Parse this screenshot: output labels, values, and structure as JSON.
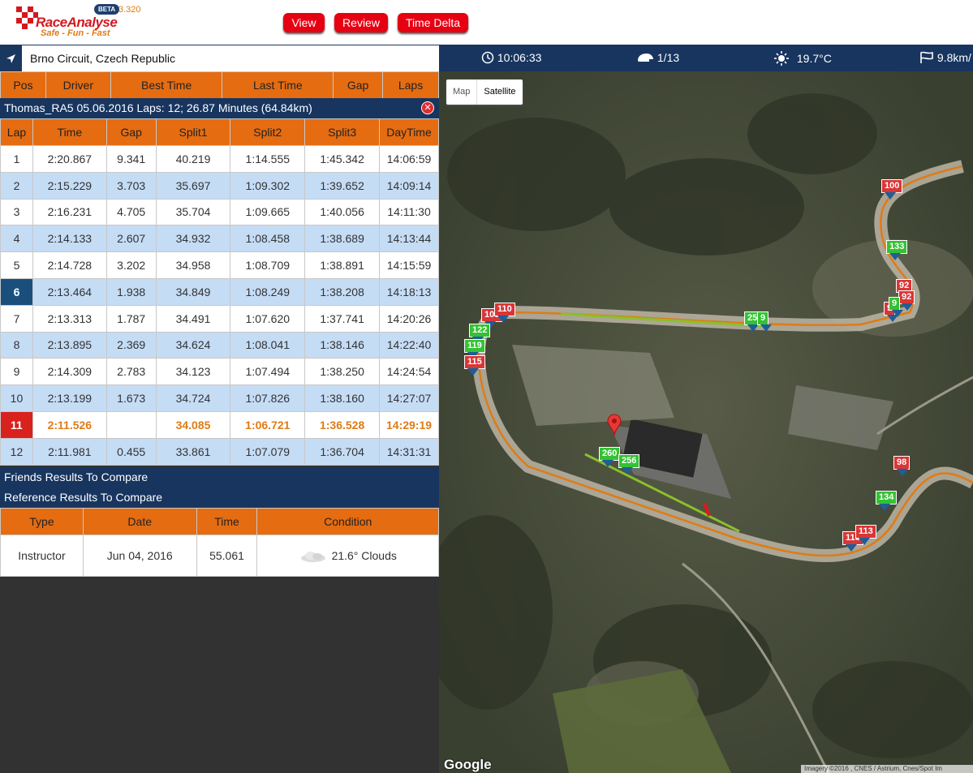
{
  "header": {
    "logo_name": "RaceAnalyse",
    "logo_slogan": "Safe - Fun - Fast",
    "beta": "BETA",
    "version": "3.320",
    "buttons": {
      "view": "View",
      "review": "Review",
      "time_delta": "Time Delta"
    }
  },
  "circuit": {
    "name": "Brno Circuit, Czech Republic",
    "icon": "navigation-arrow-icon"
  },
  "positions_table": {
    "columns": [
      "Pos",
      "Driver",
      "Best Time",
      "Last Time",
      "Gap",
      "Laps"
    ]
  },
  "session": {
    "title": "Thomas_RA5 05.06.2016 Laps: 12; 26.87 Minutes (64.84km)",
    "close_icon": "close-icon"
  },
  "laps": {
    "columns": [
      "Lap",
      "Time",
      "Gap",
      "Split1",
      "Split2",
      "Split3",
      "DayTime"
    ],
    "rows": [
      [
        "1",
        "2:20.867",
        "9.341",
        "40.219",
        "1:14.555",
        "1:45.342",
        "14:06:59"
      ],
      [
        "2",
        "2:15.229",
        "3.703",
        "35.697",
        "1:09.302",
        "1:39.652",
        "14:09:14"
      ],
      [
        "3",
        "2:16.231",
        "4.705",
        "35.704",
        "1:09.665",
        "1:40.056",
        "14:11:30"
      ],
      [
        "4",
        "2:14.133",
        "2.607",
        "34.932",
        "1:08.458",
        "1:38.689",
        "14:13:44"
      ],
      [
        "5",
        "2:14.728",
        "3.202",
        "34.958",
        "1:08.709",
        "1:38.891",
        "14:15:59"
      ],
      [
        "6",
        "2:13.464",
        "1.938",
        "34.849",
        "1:08.249",
        "1:38.208",
        "14:18:13"
      ],
      [
        "7",
        "2:13.313",
        "1.787",
        "34.491",
        "1:07.620",
        "1:37.741",
        "14:20:26"
      ],
      [
        "8",
        "2:13.895",
        "2.369",
        "34.624",
        "1:08.041",
        "1:38.146",
        "14:22:40"
      ],
      [
        "9",
        "2:14.309",
        "2.783",
        "34.123",
        "1:07.494",
        "1:38.250",
        "14:24:54"
      ],
      [
        "10",
        "2:13.199",
        "1.673",
        "34.724",
        "1:07.826",
        "1:38.160",
        "14:27:07"
      ],
      [
        "11",
        "2:11.526",
        "",
        "34.085",
        "1:06.721",
        "1:36.528",
        "14:29:19"
      ],
      [
        "12",
        "2:11.981",
        "0.455",
        "33.861",
        "1:07.079",
        "1:36.704",
        "14:31:31"
      ]
    ],
    "selected_lap": "6",
    "best_lap": "11"
  },
  "friends_title": "Friends Results To Compare",
  "reference_title": "Reference Results To Compare",
  "reference": {
    "columns": [
      "Type",
      "Date",
      "Time",
      "Condition"
    ],
    "rows": [
      {
        "type": "Instructor",
        "date": "Jun 04, 2016",
        "time": "55.061",
        "condition": "21.6° Clouds",
        "icon": "cloud-icon"
      }
    ]
  },
  "status": {
    "clock": "10:06:33",
    "laps": "1/13",
    "temperature": "19.7°C",
    "wind": "9.8km/",
    "icons": [
      "clock-icon",
      "helmet-icon",
      "sun-icon",
      "wind-flag-icon"
    ]
  },
  "map": {
    "type_buttons": [
      "Map",
      "Satellite"
    ],
    "active_type": "Satellite",
    "google_label": "Google",
    "credit": "Imagery ©2016 , CNES / Astrium, Cnes/Spot Im",
    "speed_markers": [
      {
        "label": "100",
        "color": "red"
      },
      {
        "label": "133",
        "color": "green"
      },
      {
        "label": "92",
        "color": "red"
      },
      {
        "label": "92",
        "color": "red"
      },
      {
        "label": "9",
        "color": "red"
      },
      {
        "label": "9",
        "color": "green"
      },
      {
        "label": "251",
        "color": "green"
      },
      {
        "label": "9",
        "color": "green"
      },
      {
        "label": "108",
        "color": "red"
      },
      {
        "label": "110",
        "color": "red"
      },
      {
        "label": "122",
        "color": "green"
      },
      {
        "label": "119",
        "color": "green"
      },
      {
        "label": "115",
        "color": "red"
      },
      {
        "label": "260",
        "color": "green"
      },
      {
        "label": "256",
        "color": "green"
      },
      {
        "label": "98",
        "color": "red"
      },
      {
        "label": "134",
        "color": "green"
      },
      {
        "label": "116",
        "color": "red"
      },
      {
        "label": "113",
        "color": "red"
      }
    ],
    "location_pin_icon": "map-pin-icon"
  }
}
